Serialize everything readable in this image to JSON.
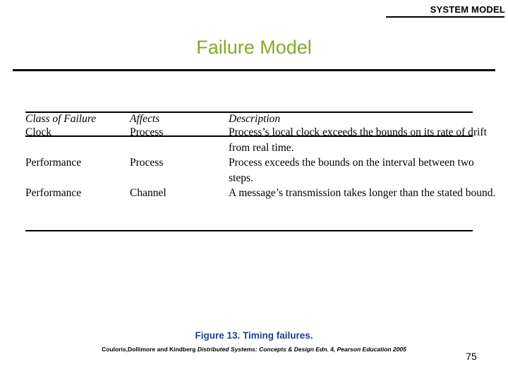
{
  "header": {
    "title": "SYSTEM MODEL"
  },
  "slide": {
    "title": "Failure Model",
    "accent_color": "#86a82a",
    "caption_color": "#1f3f8f"
  },
  "table": {
    "headers": {
      "class_of_failure": "Class of Failure",
      "affects": "Affects",
      "description": "Description"
    },
    "rows": [
      {
        "class_of_failure": "Clock",
        "affects": "Process",
        "description": "Process’s local clock exceeds the bounds on its rate of drift from real time."
      },
      {
        "class_of_failure": "Performance",
        "affects": "Process",
        "description": "Process exceeds the bounds on the interval between two steps."
      },
      {
        "class_of_failure": "Performance",
        "affects": "Channel",
        "description": "A message’s transmission takes longer than the stated bound."
      }
    ]
  },
  "figure": {
    "caption": "Figure 13. Timing failures.",
    "credit_part1": "Couloris,Dollimore and Kindberg",
    "credit_part2": "Distributed Systems: Concepts & Design",
    "credit_part3": "Edn. 4",
    "credit_part4": ", Pearson Education 2005"
  },
  "page_number": "75"
}
